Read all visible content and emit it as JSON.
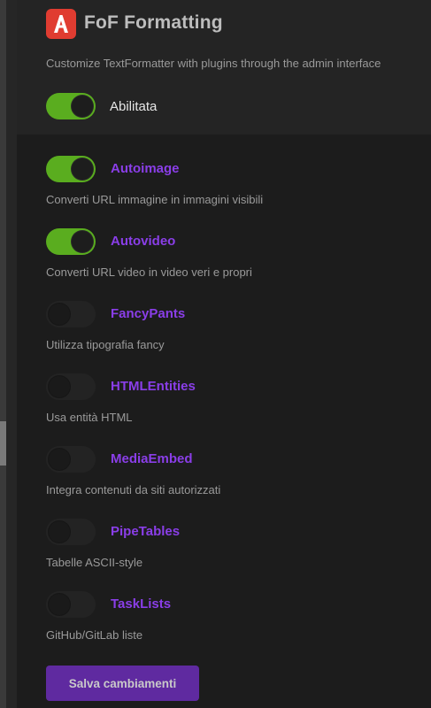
{
  "header": {
    "title": "FoF Formatting",
    "description": "Customize TextFormatter with plugins through the admin interface",
    "enabled_label": "Abilitata",
    "enabled": true
  },
  "plugins": [
    {
      "name": "Autoimage",
      "description": "Converti URL immagine in immagini visibili",
      "enabled": true
    },
    {
      "name": "Autovideo",
      "description": "Converti URL video in video veri e propri",
      "enabled": true
    },
    {
      "name": "FancyPants",
      "description": "Utilizza tipografia fancy",
      "enabled": false
    },
    {
      "name": "HTMLEntities",
      "description": "Usa entità HTML",
      "enabled": false
    },
    {
      "name": "MediaEmbed",
      "description": "Integra contenuti da siti autorizzati",
      "enabled": false
    },
    {
      "name": "PipeTables",
      "description": "Tabelle ASCII-style",
      "enabled": false
    },
    {
      "name": "TaskLists",
      "description": "GitHub/GitLab liste",
      "enabled": false
    }
  ],
  "save_button": {
    "label": "Salva cambiamenti"
  },
  "colors": {
    "accent": "#8a3ee8",
    "toggle_on": "#5aad1f",
    "logo": "#e03c31",
    "button": "#5f2aa0"
  },
  "icons": {
    "logo": "flarum-logo-icon"
  }
}
